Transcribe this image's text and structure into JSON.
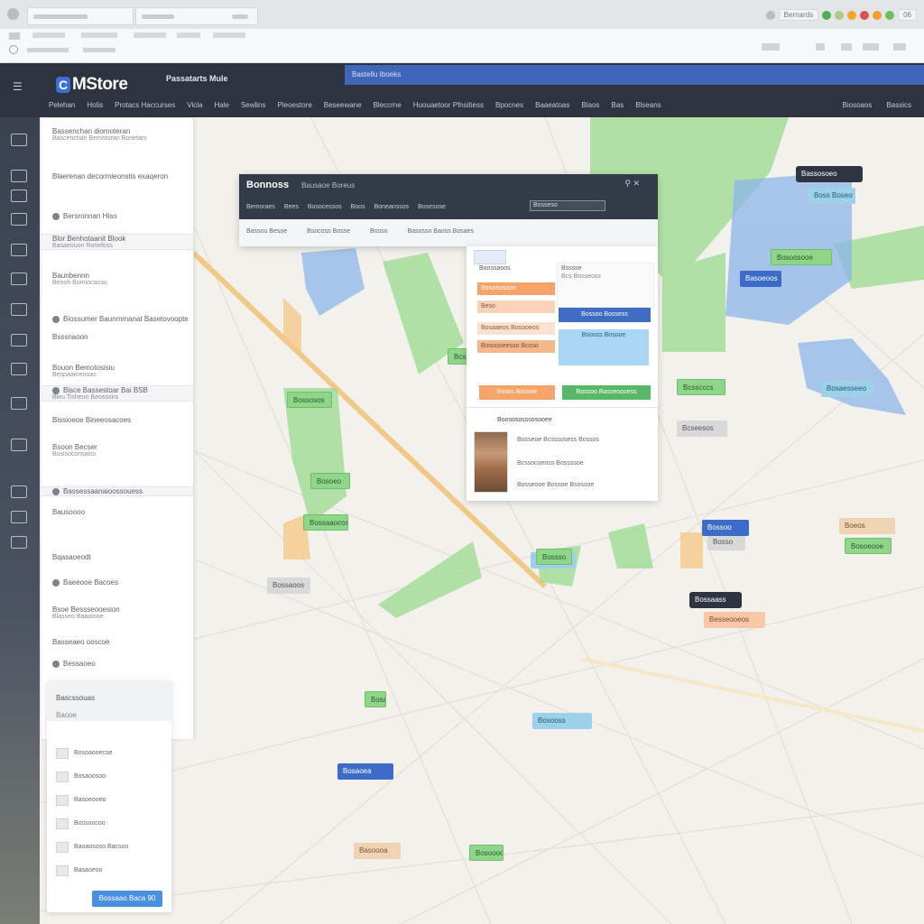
{
  "browser": {
    "tabs": [
      "",
      ""
    ],
    "toolbar_items": [
      "",
      "",
      "",
      ""
    ],
    "right_label": "Bernards",
    "right_num": "06"
  },
  "header": {
    "logo": "MStore",
    "title": "Passatarts Mule",
    "search_placeholder": "Bastellu Iboeks",
    "nav": [
      "Pelehan",
      "Holis",
      "Protacs Haccurses",
      "Vicla",
      "Hale",
      "Sewlins",
      "Pleoestore",
      "Beseewane",
      "Bleccrne",
      "Huouaetoor Pfnsitiess",
      "Bpocnes",
      "Baaeatoas",
      "Blaos",
      "Bas",
      "Blseans"
    ],
    "right_nav": [
      "Biosoaos",
      "Bassics"
    ]
  },
  "left_panel": {
    "rows": [
      {
        "title": "Bassenchan diomoteran",
        "sub": "Bascenchan Bemotoran Bonetars"
      },
      {
        "title": "Blaerenan decormieonstis exaqeron",
        "sub": ""
      },
      {
        "title": "Bersronnan Hiso",
        "sub": ""
      },
      {
        "title": "Blor Benhotaanit Blook",
        "sub": "Basaeouon Ronefoss"
      },
      {
        "title": "Baunbennn",
        "sub": "Beooh Bomiocaosu"
      },
      {
        "title": "Biossumer Baunmmanat Basetovoopte",
        "sub": ""
      },
      {
        "title": "Bsssnaoon",
        "sub": ""
      },
      {
        "title": "Bouon Bemotosisiu",
        "sub": "Bespaamenoas"
      },
      {
        "title": "Bisce Bassestoar Bai BSB",
        "sub": "Bleu Tisheun Beossoirs"
      },
      {
        "title": "Bissioeoe Bineeosacoes",
        "sub": ""
      },
      {
        "title": "Bsoon Becser",
        "sub": "Busisocorxiaiss"
      },
      {
        "title": "Bassessaanaioossouess",
        "sub": ""
      },
      {
        "title": "Bausoooo",
        "sub": ""
      },
      {
        "title": "Bqasaoeodt",
        "sub": ""
      },
      {
        "title": "Baeeooe Bacoes",
        "sub": ""
      },
      {
        "title": "Bsoe Bessseooesion",
        "sub": "Blasseo Baaaiooe"
      },
      {
        "title": "Basseaeo ooscoe",
        "sub": ""
      },
      {
        "title": "Bessaoeo",
        "sub": ""
      }
    ]
  },
  "bottom_card": {
    "title": "Bascssouas",
    "sub": "Baooe",
    "lines": [
      "Bosoaooecse",
      "Bosaoosoo",
      "Basoeooeo",
      "Bossoocoo",
      "Baoaososo Bacsoo",
      "Basaoeoo"
    ],
    "button": "Bossaao Baca 90"
  },
  "modal": {
    "title": "Bonnoss",
    "subtitle": "Bausaoe Boreus",
    "tabs": [
      "Bemoraes",
      "Bees",
      "Bosocessos",
      "Boos",
      "Boneanssos",
      "Bosesose"
    ],
    "input": "Bosseso",
    "subnav": [
      "Bassou Besoe",
      "Bsocoss Bosse",
      "Bosso",
      "Basosso Baoss Bosaes"
    ]
  },
  "detail": {
    "header": "Boossaoos",
    "list_label": "Bsssse",
    "tags": [
      "Bosoeosaoo",
      "Beso",
      "Bosaaeos Bosooeos",
      "Bosoooeesso Bcoso"
    ],
    "right_labels": [
      "Boso",
      "Bcs Bosseoss"
    ],
    "blue_btn": "Bossoo Bossess",
    "light_btn": "Boosss Bosooe",
    "btn_orange": "Bosss Bossoe",
    "btn_green": "Bossoo Basseoosess",
    "profile_title": "Boosososssosooee",
    "profile_lines": [
      "Bosseoe Bcsssosess Bossos",
      "Bcssocoeoss Bossssoe",
      "Bosseooe Bossoe Bsossoe"
    ]
  },
  "map_labels": [
    {
      "text": "Bassosoeo",
      "style": "dark"
    },
    {
      "text": "Boss Boseo",
      "style": "blue"
    },
    {
      "text": "Bosoosooe",
      "style": "green"
    },
    {
      "text": "Bosaesseeo",
      "style": "blue"
    },
    {
      "text": "Bcssoss",
      "style": "green"
    },
    {
      "text": "Bossosos",
      "style": "green"
    },
    {
      "text": "Bossaaocosse",
      "style": "green"
    },
    {
      "text": "Bosoeos",
      "style": "blue"
    },
    {
      "text": "Bossaoos",
      "style": "gray"
    },
    {
      "text": "Bcsscccs",
      "style": "green"
    },
    {
      "text": "Bcseesos",
      "style": "gray"
    },
    {
      "text": "Bossaass",
      "style": "dark"
    },
    {
      "text": "Besseooeos",
      "style": "peach"
    },
    {
      "text": "Bosso",
      "style": "gray"
    },
    {
      "text": "Bosooss",
      "style": "blue"
    },
    {
      "text": "Bossoo",
      "style": "navy"
    },
    {
      "text": "Bosaoea",
      "style": "navy"
    },
    {
      "text": "Bosoooo",
      "style": "green"
    },
    {
      "text": "Basoooa",
      "style": "tan"
    },
    {
      "text": "Bosaoo",
      "style": "green"
    },
    {
      "text": "Bosoeooe",
      "style": "green"
    },
    {
      "text": "Bosoeo",
      "style": "green"
    },
    {
      "text": "Basoeoos",
      "style": "navy"
    },
    {
      "text": "Boeos",
      "style": "tan"
    },
    {
      "text": "Bossso",
      "style": "green"
    }
  ]
}
